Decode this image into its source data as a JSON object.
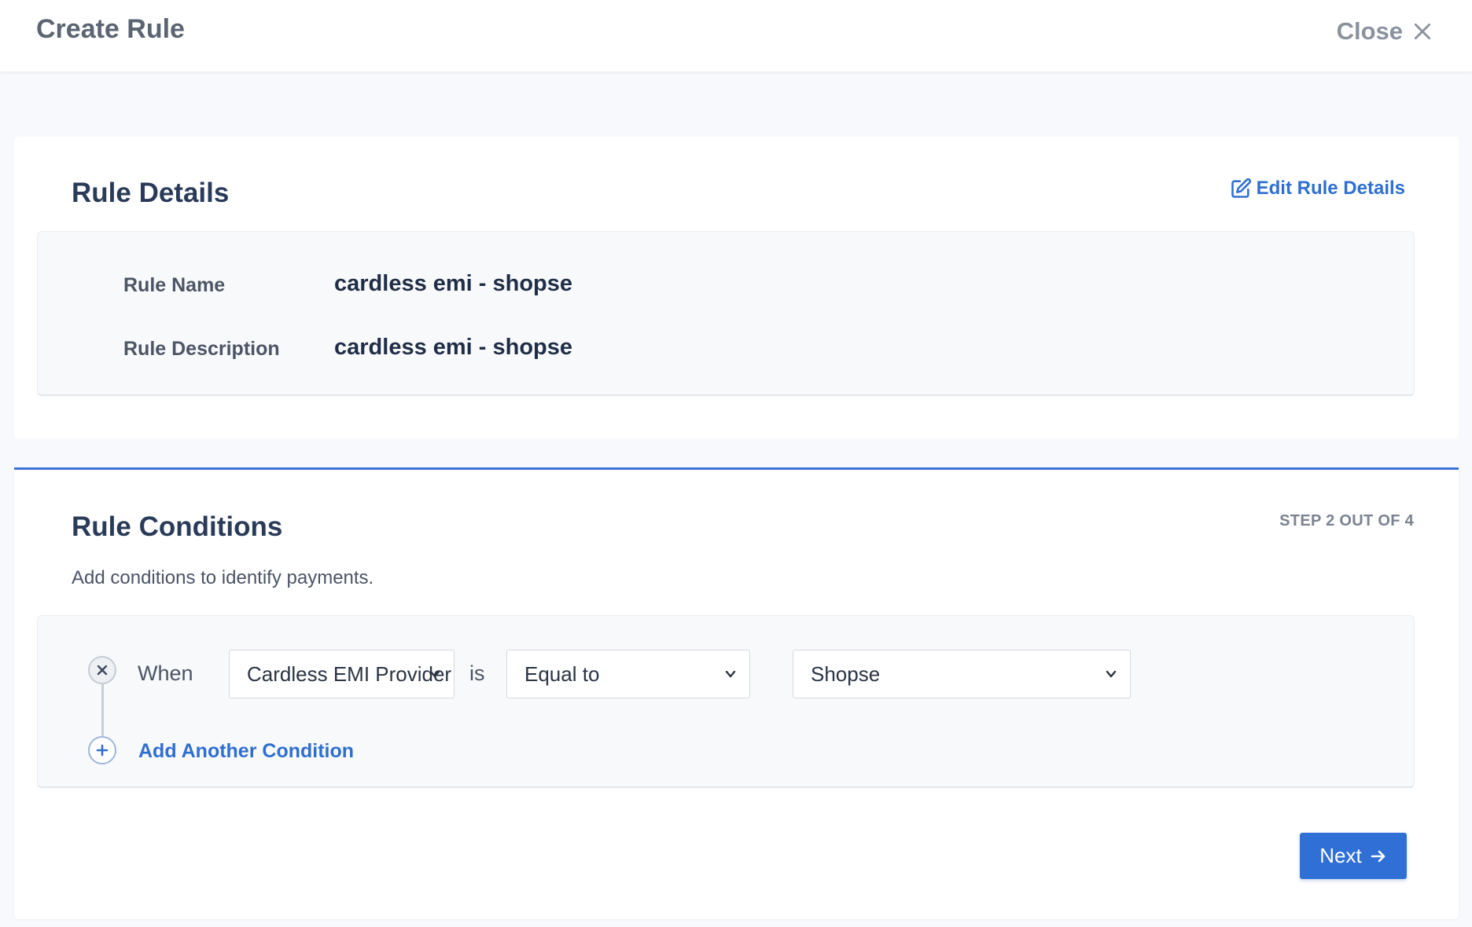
{
  "header": {
    "title": "Create Rule",
    "close_label": "Close"
  },
  "rule_details": {
    "title": "Rule Details",
    "edit_label": "Edit Rule Details",
    "fields": [
      {
        "label": "Rule Name",
        "value": "cardless emi - shopse"
      },
      {
        "label": "Rule Description",
        "value": "cardless emi - shopse"
      }
    ]
  },
  "rule_conditions": {
    "title": "Rule Conditions",
    "step_label": "STEP 2 OUT OF 4",
    "subtitle": "Add conditions to identify payments.",
    "condition": {
      "when_label": "When",
      "field": "Cardless EMI Provider",
      "is_label": "is",
      "operator": "Equal to",
      "value": "Shopse"
    },
    "add_condition_label": "Add Another Condition",
    "next_label": "Next"
  },
  "colors": {
    "accent": "#2f6fd6",
    "link": "#2f6fd1",
    "divider": "#3a73d4"
  },
  "icons": {
    "close": "close-icon",
    "edit": "edit-icon",
    "remove": "remove-condition-icon",
    "add": "plus-icon",
    "chevron": "chevron-down-icon",
    "next": "arrow-right-icon"
  }
}
